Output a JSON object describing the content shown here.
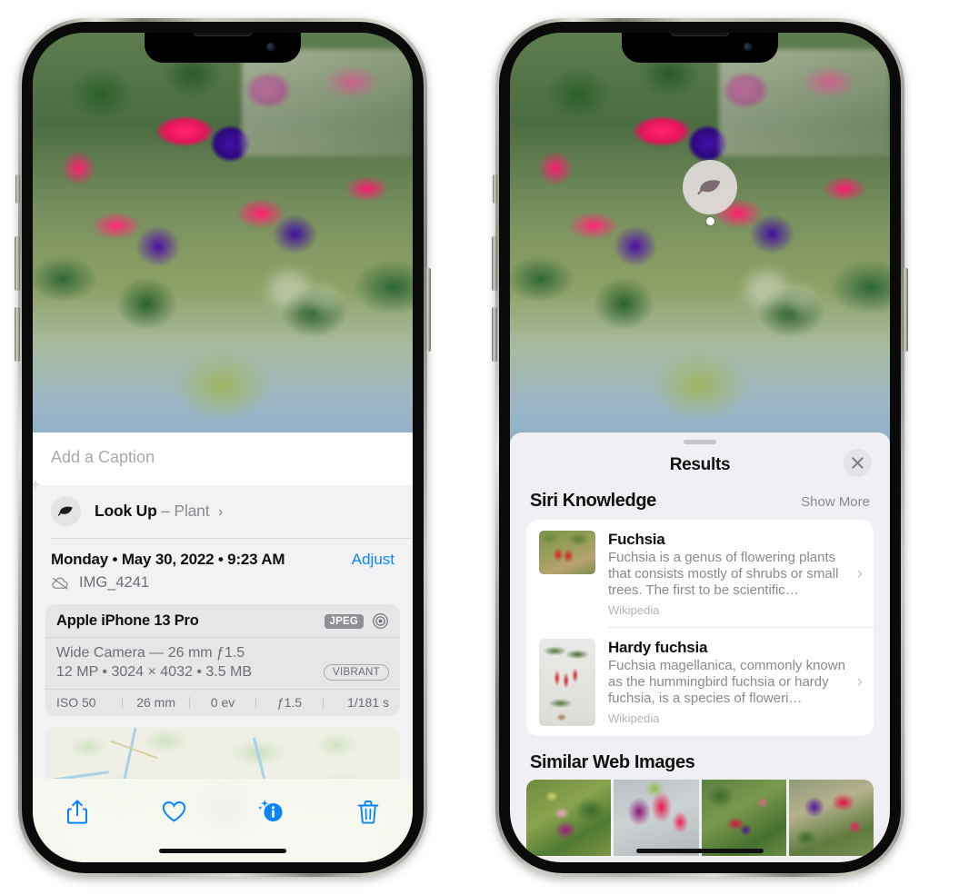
{
  "phones": {
    "left": {
      "name": "iphone-photos-detail",
      "caption": {
        "placeholder": "Add a Caption"
      },
      "lookup": {
        "label": "Look Up",
        "dash": "–",
        "subject": "Plant",
        "chevron": "›",
        "icon": "leaf-icon"
      },
      "meta": {
        "date": "Monday • May 30, 2022 • 9:23 AM",
        "adjust_label": "Adjust",
        "filename": "IMG_4241",
        "cloud_icon": "icloud-slash-icon"
      },
      "camera_card": {
        "device": "Apple iPhone 13 Pro",
        "format_badge": "JPEG",
        "aperture_icon": "aperture-icon",
        "lens_line": "Wide Camera — 26 mm ƒ1.5",
        "specs_line": "12 MP • 3024 × 4032 • 3.5 MB",
        "style_badge": "VIBRANT",
        "exif": [
          "ISO 50",
          "26 mm",
          "0 ev",
          "ƒ1.5",
          "1/181 s"
        ]
      },
      "toolbar": [
        {
          "name": "share-button",
          "icon": "share-icon"
        },
        {
          "name": "favorite-button",
          "icon": "heart-icon"
        },
        {
          "name": "info-button",
          "icon": "info-sparkle-icon"
        },
        {
          "name": "delete-button",
          "icon": "trash-icon"
        }
      ],
      "accent": "#0a84ff"
    },
    "right": {
      "name": "iphone-visual-lookup-results",
      "badge": {
        "icon": "leaf-icon"
      },
      "sheet": {
        "title": "Results",
        "close_icon": "close-icon",
        "sections": [
          {
            "title": "Siri Knowledge",
            "action": "Show More",
            "items": [
              {
                "title": "Fuchsia",
                "description": "Fuchsia is a genus of flowering plants that consists mostly of shrubs or small trees. The first to be scientific…",
                "source": "Wikipedia",
                "chevron": "›"
              },
              {
                "title": "Hardy fuchsia",
                "description": "Fuchsia magellanica, commonly known as the hummingbird fuchsia or hardy fuchsia, is a species of floweri…",
                "source": "Wikipedia",
                "chevron": "›"
              }
            ]
          },
          {
            "title": "Similar Web Images",
            "images": [
              "web-image-1",
              "web-image-2",
              "web-image-3",
              "web-image-4"
            ]
          }
        ]
      }
    }
  },
  "colors": {
    "accent_blue": "#0a84ff",
    "sheet_bg": "#f0f0f4",
    "card_bg": "#ffffff",
    "secondary_text": "#8a8a8e"
  }
}
